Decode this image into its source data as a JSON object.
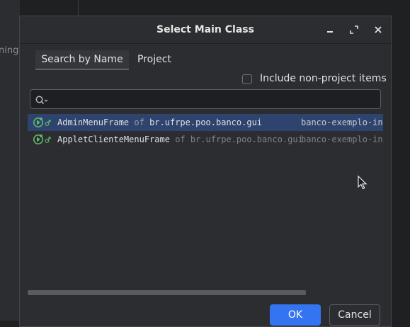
{
  "background": {
    "partial_text": "ning"
  },
  "dialog": {
    "title": "Select Main Class",
    "tabs": [
      {
        "label": "Search by Name",
        "selected": true
      },
      {
        "label": "Project",
        "selected": false
      }
    ],
    "include_non_project": {
      "label": "Include non-project items",
      "checked": false
    },
    "search": {
      "value": "",
      "placeholder": ""
    },
    "results": [
      {
        "class": "AdminMenuFrame",
        "of": "of",
        "package": "br.ufrpe.poo.banco.gui",
        "module": "banco-exemplo-int",
        "selected": true
      },
      {
        "class": "AppletClienteMenuFrame",
        "of": "of",
        "package": "br.ufrpe.poo.banco.gui",
        "module": "banco-exemplo-interfac",
        "selected": false
      }
    ],
    "buttons": {
      "ok": "OK",
      "cancel": "Cancel"
    }
  },
  "colors": {
    "accent": "#3574f0",
    "selection": "#2e436e",
    "icon_green": "#5fb865",
    "dialog_bg": "#2b2d30"
  },
  "icons": [
    "minimize-icon",
    "maximize-icon",
    "close-icon",
    "search-icon",
    "run-class-icon",
    "mouse-cursor-icon"
  ]
}
